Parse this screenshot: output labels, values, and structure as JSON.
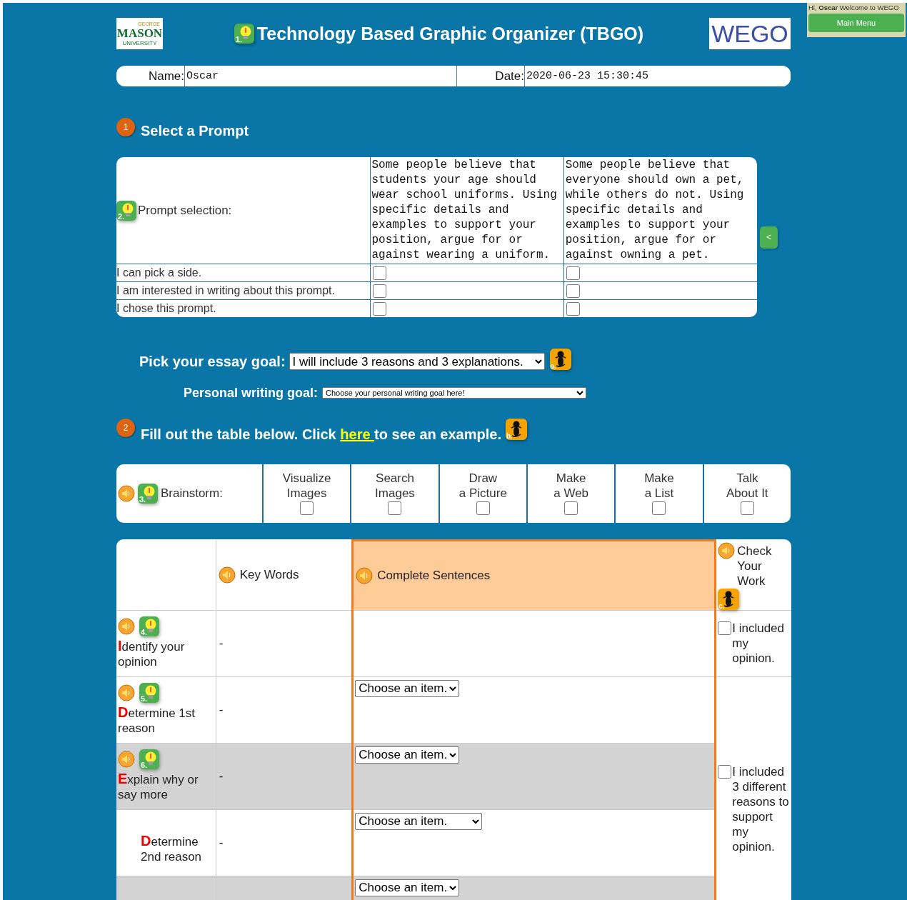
{
  "header": {
    "logo_left": [
      "GEORGE",
      "MASON",
      "UNIVERSITY"
    ],
    "title_badge": "1.",
    "title": "Technology Based Graphic Organizer (TBGO)",
    "logo_right": "WEGO"
  },
  "user_panel": {
    "greeting": "Hi, **Oscar** Welcome to WEGO",
    "button": "Main Menu"
  },
  "info_bar": {
    "name_label": "Name:",
    "name_value": "Oscar",
    "date_label": "Date:",
    "date_value": "2020-06-23 15:30:45"
  },
  "step1": {
    "number": "1",
    "heading": "Select a Prompt"
  },
  "prompt_table": {
    "badge": "2.",
    "label": "Prompt selection:",
    "prompts": [
      "Some people believe that students your age should wear school uniforms. Using specific details and examples to support your position, argue for or against wearing a uniform.",
      "Some people believe that everyone should own a pet, while others do not. Using specific details and examples to support your position, argue for or against owning a pet."
    ],
    "criteria": [
      {
        "label": "I can pick a side.",
        "checks": [
          false,
          false
        ]
      },
      {
        "label": "I am interested in writing about this prompt.",
        "checks": [
          false,
          false
        ]
      },
      {
        "label": "I chose this prompt.",
        "checks": [
          false,
          false
        ]
      }
    ]
  },
  "side_tab": "<",
  "essay_goal": {
    "label": "Pick your essay goal:",
    "value": "I will include 3 reasons and 3 explanations.",
    "help_badge": "a."
  },
  "personal_goal": {
    "label": "Personal writing goal:",
    "value": "Choose your personal writing goal here!"
  },
  "step2": {
    "number": "2",
    "before": "Fill out the table below. Click ",
    "link": "here ",
    "after": "to see an example.",
    "help_badge": "b."
  },
  "brainstorm": {
    "badge": "3.",
    "label": "Brainstorm:",
    "options": [
      {
        "label": "Visualize\nImages",
        "checked": false
      },
      {
        "label": "Search\nImages",
        "checked": false
      },
      {
        "label": "Draw\na Picture",
        "checked": false
      },
      {
        "label": "Make\na Web",
        "checked": false
      },
      {
        "label": "Make\na List",
        "checked": false
      },
      {
        "label": "Talk\nAbout It",
        "checked": false
      }
    ]
  },
  "organizer": {
    "key_words": "Key Words",
    "sentences": "Complete Sentences",
    "check_heading": "Check Your Work",
    "check_badge": "c.",
    "rows": [
      {
        "kind": "step",
        "badge": "4.",
        "initial": "I",
        "text": "dentify your opinion",
        "key_words": "-",
        "shaded": false
      },
      {
        "kind": "step",
        "badge": "5.",
        "initial": "D",
        "text": "etermine 1st reason",
        "key_words": "-",
        "select": "Choose an item.",
        "shaded": false
      },
      {
        "kind": "step",
        "badge": "6.",
        "initial": "E",
        "text": "xplain why or say more",
        "key_words": "-",
        "select": "Choose an item.",
        "shaded": true
      },
      {
        "kind": "sub",
        "initial": "D",
        "text": "etermine 2nd reason",
        "key_words": "-",
        "select": "Choose an item.",
        "wide": true,
        "shaded": false
      },
      {
        "kind": "blank",
        "select": "Choose an item.",
        "shaded": true
      }
    ],
    "checks": [
      {
        "label": "I included my opinion.",
        "checked": false
      },
      {
        "label": "I included 3 different reasons to support my opinion.",
        "checked": false
      }
    ]
  }
}
